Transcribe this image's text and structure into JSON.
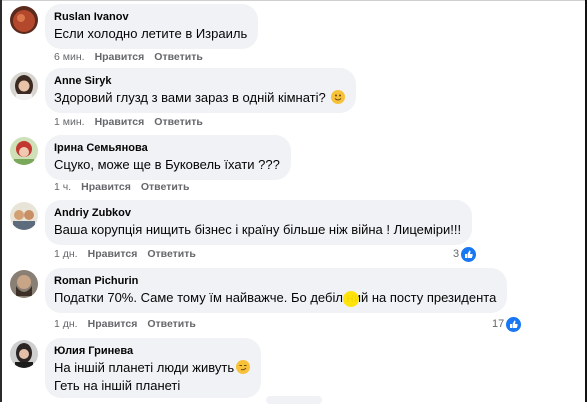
{
  "actions": {
    "like": "Нравится",
    "reply": "Ответить"
  },
  "comments": [
    {
      "author": "Ruslan Ivanov",
      "text": "Если холодно летите в Израиль",
      "time": "6 мин."
    },
    {
      "author": "Anne Siryk",
      "text": "Здоровий глузд з вами зараз в одній кімнаті?",
      "time": "1 мин."
    },
    {
      "author": "Ірина Семьянова",
      "text": "Сцуко, може ще в Буковель їхати ???",
      "time": "1 ч."
    },
    {
      "author": "Andriy Zubkov",
      "text": "Ваша корупція нищить бізнес і країну більше ніж війна ! Лицеміри!!!",
      "time": "1 дн.",
      "likes": "3"
    },
    {
      "author": "Roman Pichurin",
      "text": "Податки 70%. Саме тому їм найважче. Бо дебіл   ний на посту президента",
      "time": "1 дн.",
      "likes": "17"
    },
    {
      "author": "Юлия Гринева",
      "text": "На іншій планеті люди живуть",
      "text2": "Геть на іншій планеті"
    }
  ],
  "icons": [
    "profile-avatar",
    "smile-emoji-icon",
    "like-thumb-icon",
    "smirk-emoji-icon"
  ],
  "colors": {
    "bubble": "#f0f2f5",
    "meta": "#65676b",
    "like": "#1877f2",
    "highlight": "#ffe200"
  }
}
